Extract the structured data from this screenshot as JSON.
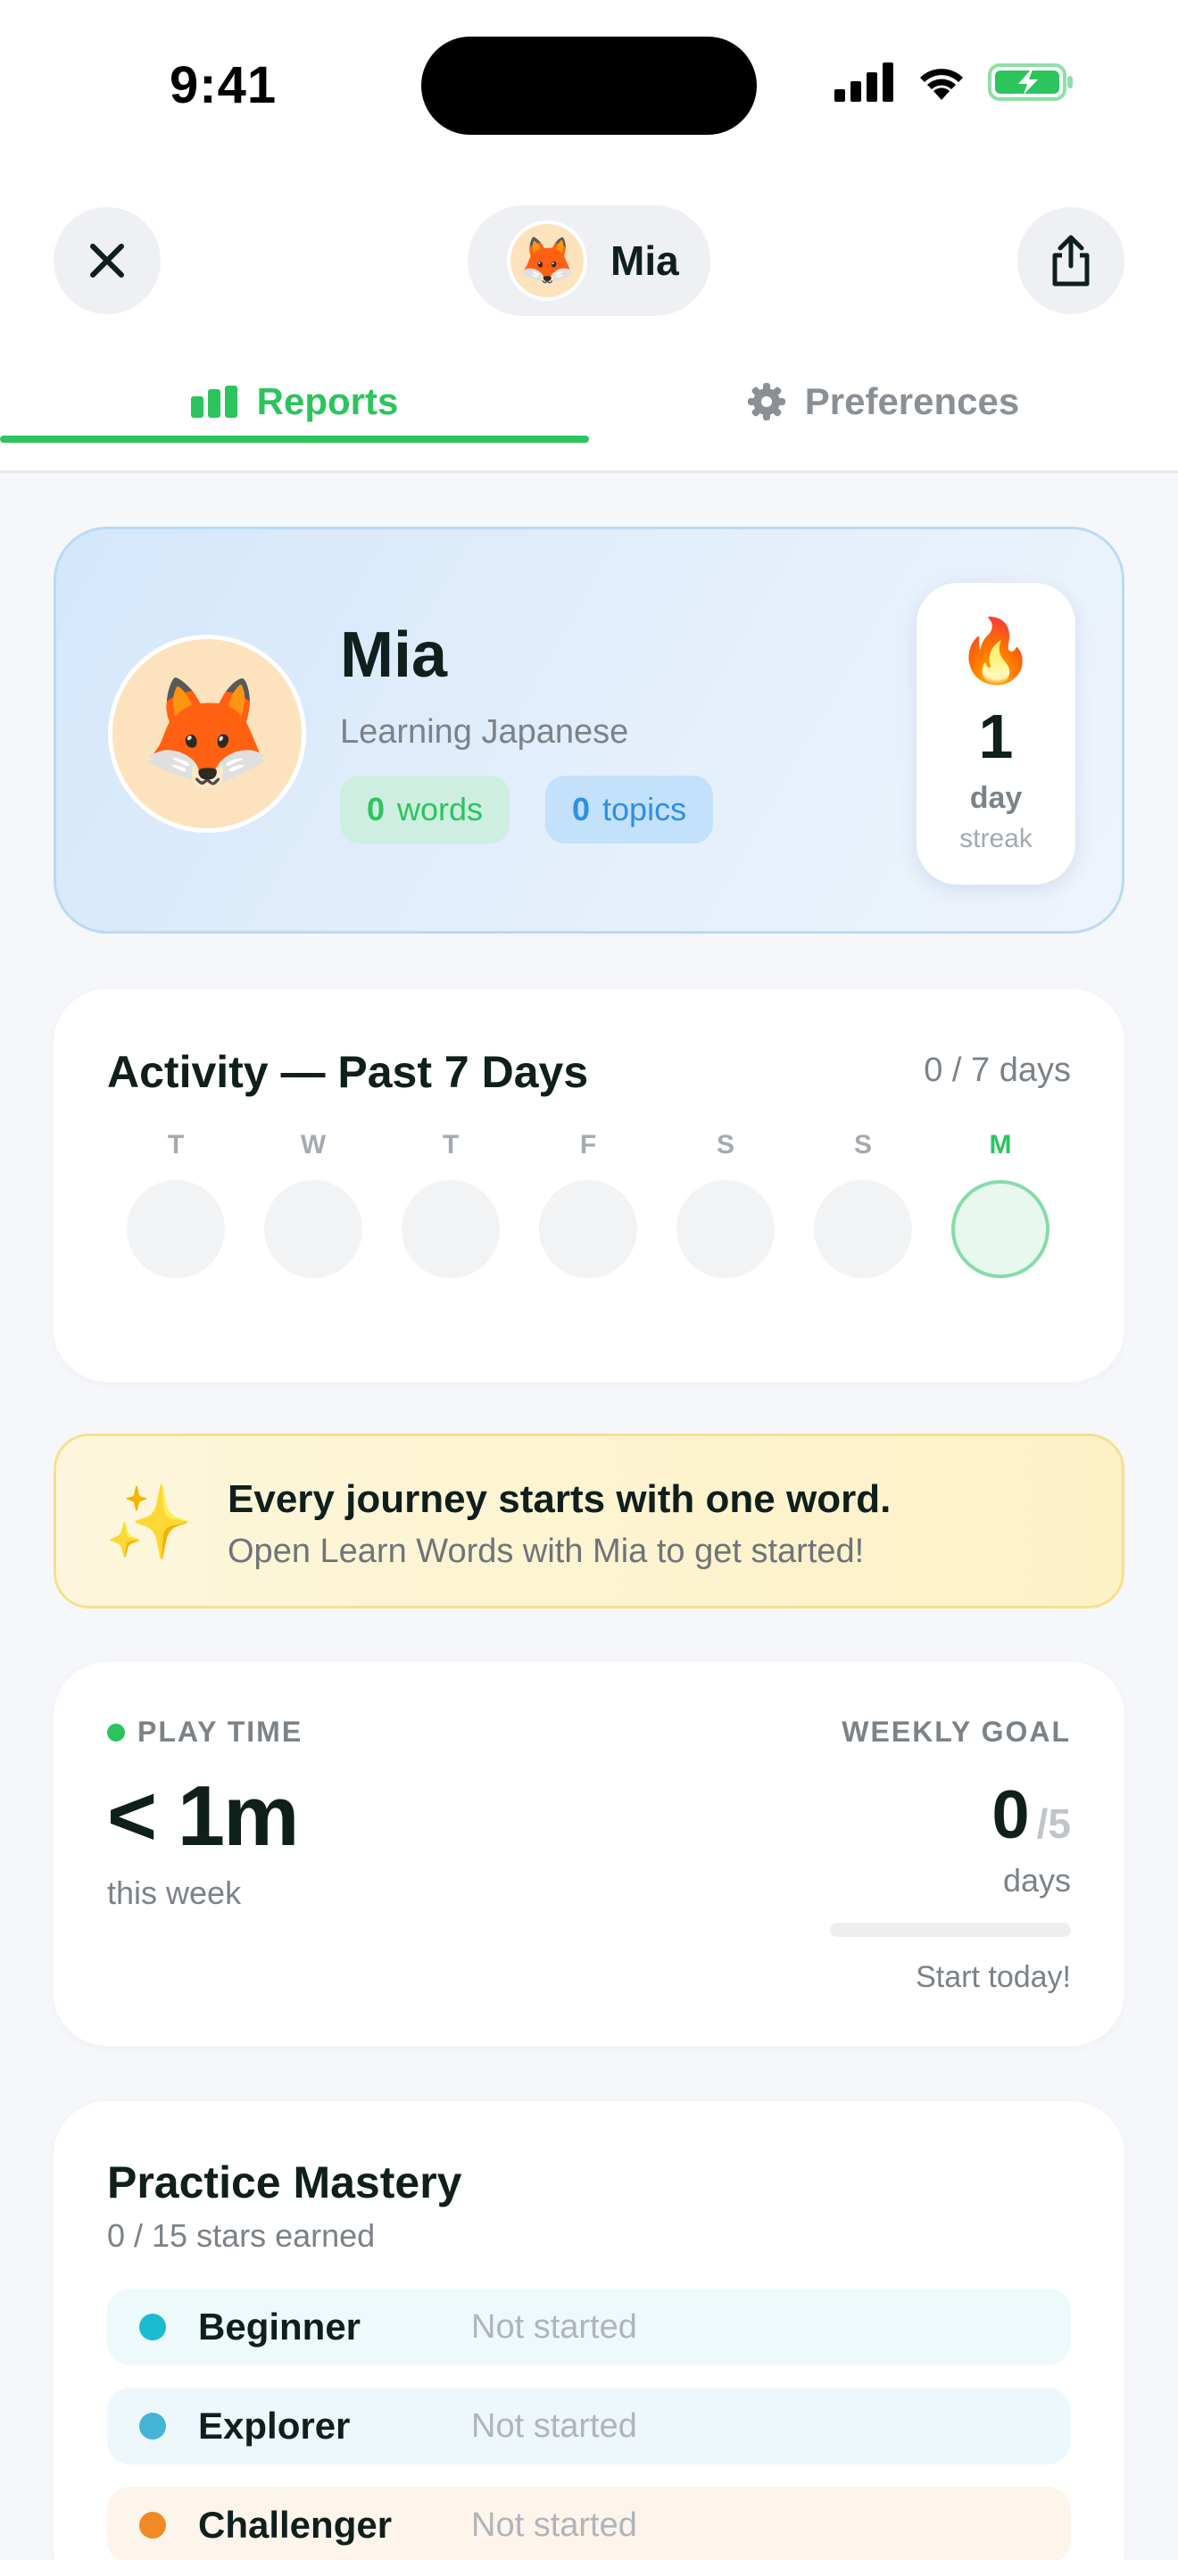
{
  "status_bar": {
    "time": "9:41"
  },
  "header": {
    "profile_name": "Mia",
    "avatar_emoji": "🦊"
  },
  "tabs": [
    {
      "label": "Reports",
      "icon": "bar-chart-icon",
      "active": true
    },
    {
      "label": "Preferences",
      "icon": "gear-icon",
      "active": false
    }
  ],
  "profile_card": {
    "avatar_emoji": "🦊",
    "name": "Mia",
    "subtitle": "Learning Japanese",
    "words_count": "0",
    "words_label": "words",
    "topics_count": "0",
    "topics_label": "topics",
    "streak_icon": "🔥",
    "streak_value": "1",
    "streak_unit": "day",
    "streak_label": "streak"
  },
  "activity": {
    "title": "Activity — Past 7 Days",
    "count": "0 / 7 days",
    "days": [
      {
        "letter": "T",
        "today": false
      },
      {
        "letter": "W",
        "today": false
      },
      {
        "letter": "T",
        "today": false
      },
      {
        "letter": "F",
        "today": false
      },
      {
        "letter": "S",
        "today": false
      },
      {
        "letter": "S",
        "today": false
      },
      {
        "letter": "M",
        "today": true
      }
    ]
  },
  "banner": {
    "icon": "✨",
    "title": "Every journey starts with one word.",
    "subtitle": "Open Learn Words with Mia to get started!"
  },
  "play_time": {
    "label": "PLAY TIME",
    "value": "< 1m",
    "sub": "this week",
    "goal_label": "WEEKLY GOAL",
    "goal_value": "0",
    "goal_total": "/5",
    "goal_unit": "days",
    "goal_progress": 0,
    "goal_hint": "Start today!"
  },
  "mastery": {
    "title": "Practice Mastery",
    "subtitle": "0 / 15 stars earned",
    "levels": [
      {
        "name": "Beginner",
        "status": "Not started",
        "dot_color": "#19bcd0",
        "bg_color": "#eef9fb"
      },
      {
        "name": "Explorer",
        "status": "Not started",
        "dot_color": "#45b3d6",
        "bg_color": "#eef7fb"
      },
      {
        "name": "Challenger",
        "status": "Not started",
        "dot_color": "#f08a24",
        "bg_color": "#fdf4ec"
      }
    ]
  },
  "colors": {
    "accent_green": "#2cc45d",
    "topic_blue": "#2d8fe8"
  }
}
